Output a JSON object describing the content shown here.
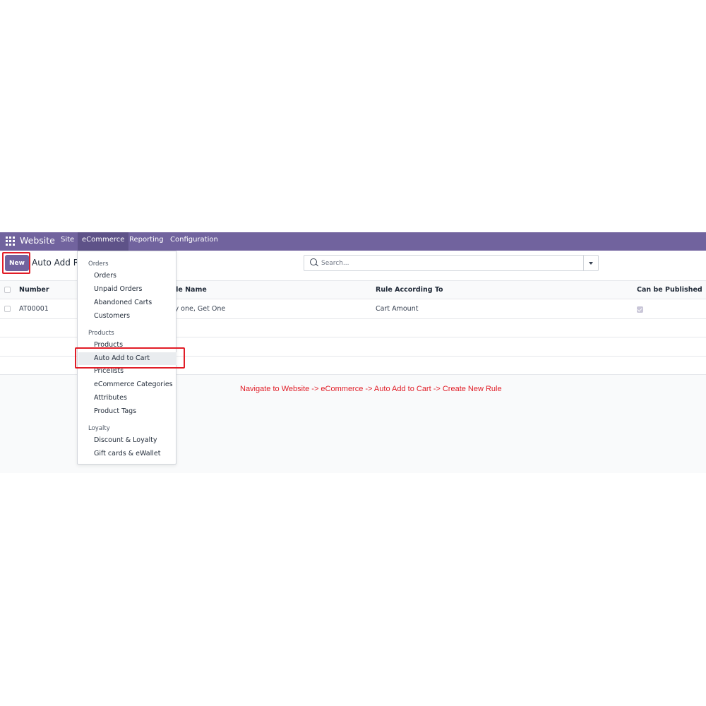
{
  "navbar": {
    "brand": "Website",
    "menus": [
      "Site",
      "eCommerce",
      "Reporting",
      "Configuration"
    ],
    "active_menu": "eCommerce",
    "color": "#71639e"
  },
  "control_panel": {
    "new_label": "New",
    "breadcrumb": "Auto Add Ru",
    "search_placeholder": "Search..."
  },
  "table": {
    "columns": [
      "Number",
      "Rule Name",
      "Rule According To",
      "Can be Published"
    ],
    "rows": [
      {
        "number": "AT00001",
        "rule_name": "Buy one, Get One",
        "rule_according_to": "Cart Amount",
        "can_be_published": true
      }
    ]
  },
  "dropdown": {
    "sections": [
      {
        "header": "Orders",
        "items": [
          "Orders",
          "Unpaid Orders",
          "Abandoned Carts",
          "Customers"
        ]
      },
      {
        "header": "Products",
        "items": [
          "Products",
          "Auto Add to Cart",
          "Pricelists",
          "eCommerce Categories",
          "Attributes",
          "Product Tags"
        ]
      },
      {
        "header": "Loyalty",
        "items": [
          "Discount & Loyalty",
          "Gift cards & eWallet"
        ]
      }
    ],
    "highlighted_item": "Auto Add to Cart"
  },
  "annotation": {
    "text": "Navigate to Website -> eCommerce -> Auto Add to Cart -> Create New Rule",
    "color": "#e11d27"
  }
}
